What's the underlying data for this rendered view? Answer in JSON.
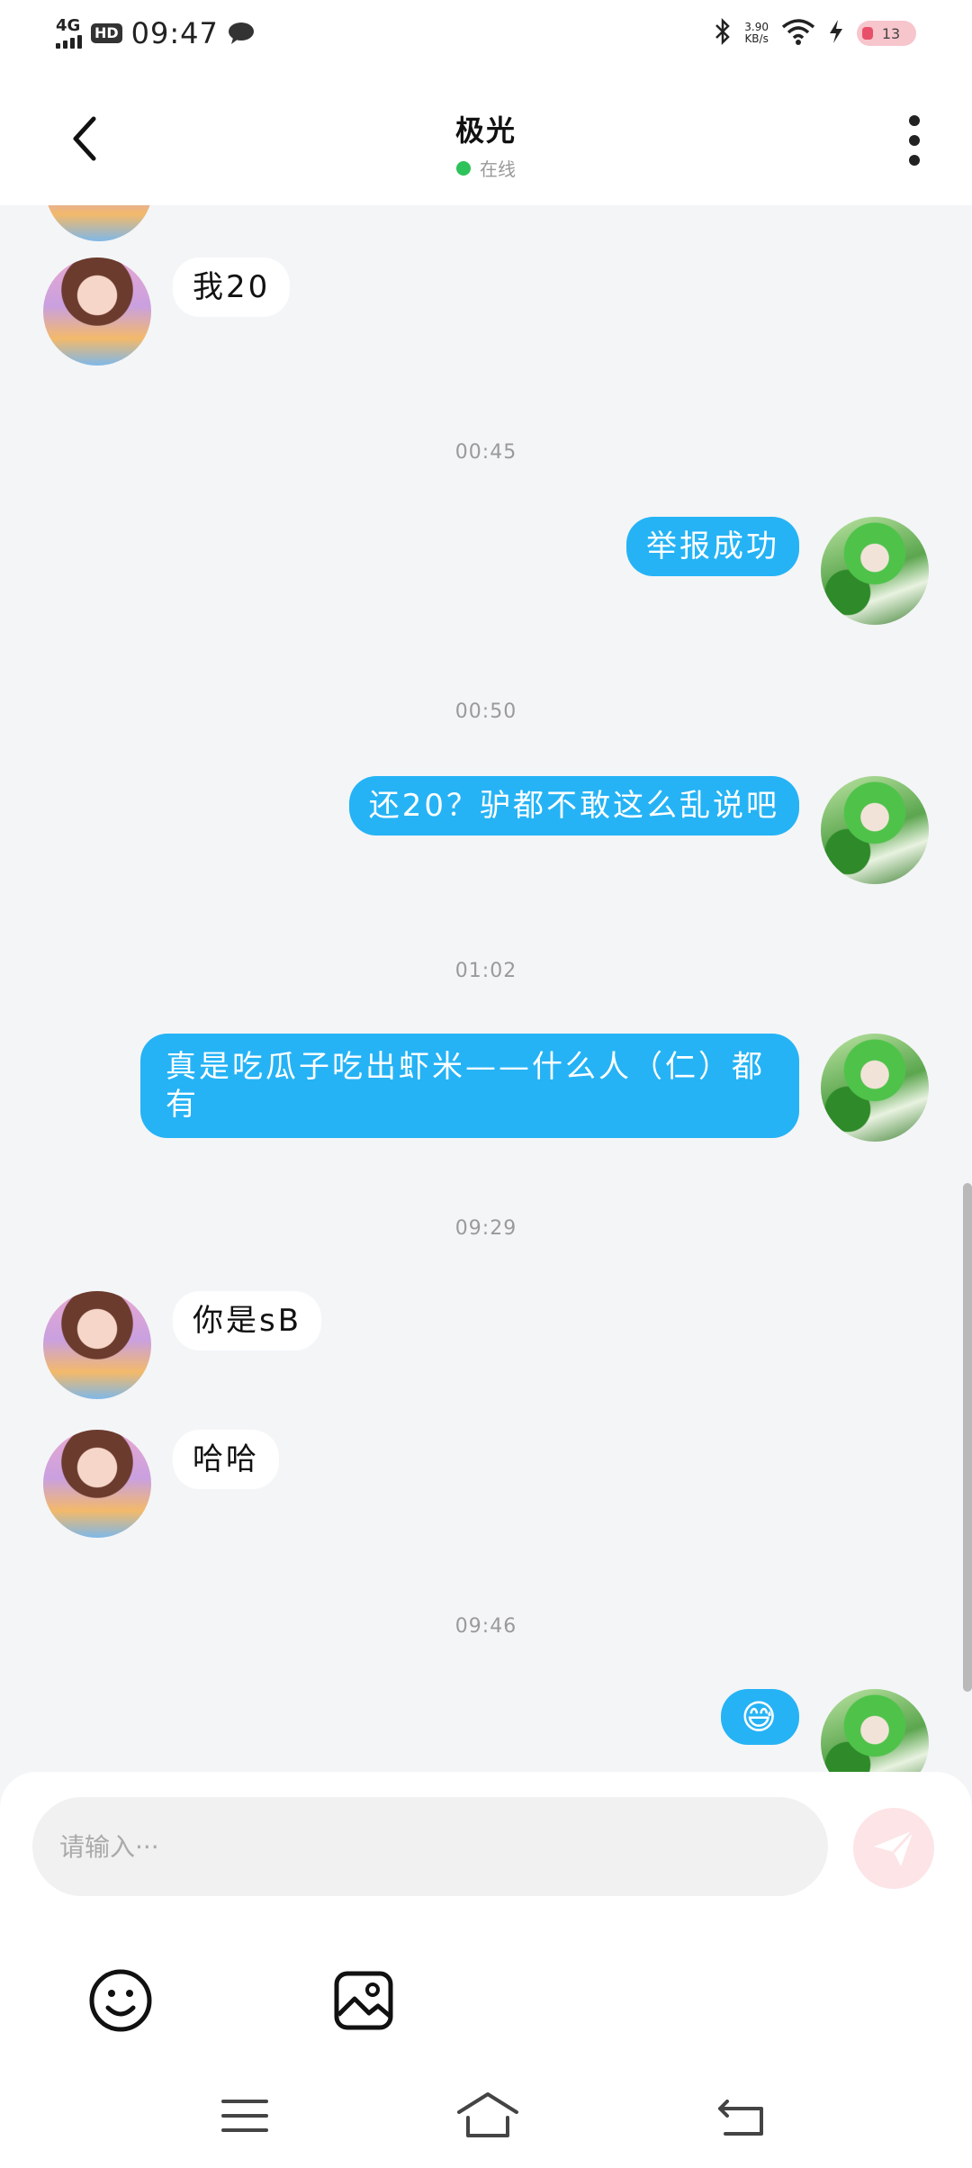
{
  "status_bar": {
    "network": "4G",
    "hd": "HD",
    "time": "09:47",
    "speed_value": "3.90",
    "speed_unit": "KB/s",
    "battery": "13"
  },
  "header": {
    "title": "极光",
    "status": "在线"
  },
  "messages": [
    {
      "type": "text",
      "side": "in",
      "text": "我20"
    },
    {
      "type": "time",
      "text": "00:45"
    },
    {
      "type": "text",
      "side": "out",
      "text": "举报成功"
    },
    {
      "type": "time",
      "text": "00:50"
    },
    {
      "type": "text",
      "side": "out",
      "text": "还20？驴都不敢这么乱说吧"
    },
    {
      "type": "time",
      "text": "01:02"
    },
    {
      "type": "text",
      "side": "out",
      "line1": "真是吃瓜子吃出虾米——什么人（仁）都",
      "line2": "有"
    },
    {
      "type": "time",
      "text": "09:29"
    },
    {
      "type": "text",
      "side": "in",
      "text": "你是sB"
    },
    {
      "type": "text",
      "side": "in",
      "text": "哈哈"
    },
    {
      "type": "time",
      "text": "09:46"
    },
    {
      "type": "emoji",
      "side": "out",
      "text": "😅"
    }
  ],
  "input": {
    "placeholder": "请输入···"
  },
  "colors": {
    "outgoing_bubble": "#25b3f5",
    "incoming_bubble": "#ffffff",
    "background": "#f4f5f7",
    "online_dot": "#2ec25a",
    "send_button": "#fde4e6"
  },
  "icons": {
    "back": "chevron-left-icon",
    "more": "more-vertical-icon",
    "send": "paper-plane-icon",
    "emoji": "smiley-icon",
    "image": "image-icon",
    "nav_menu": "menu-icon",
    "nav_home": "home-icon",
    "nav_back": "return-icon"
  }
}
